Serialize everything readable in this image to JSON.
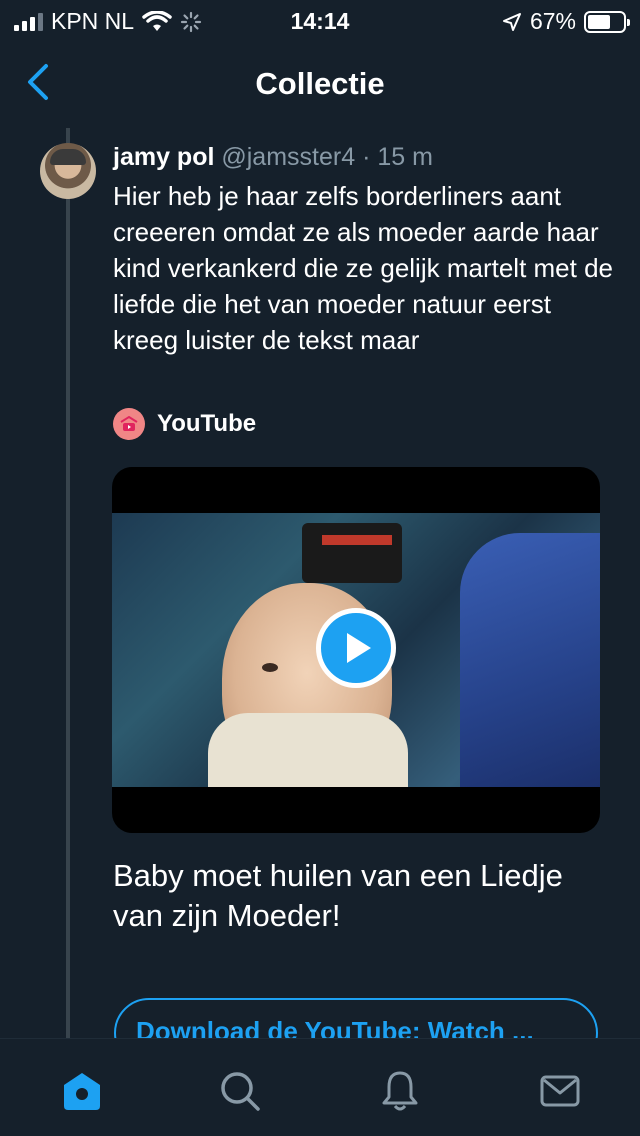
{
  "status_bar": {
    "carrier": "KPN NL",
    "time": "14:14",
    "battery": "67%"
  },
  "nav": {
    "title": "Collectie"
  },
  "tweet": {
    "name": "jamy pol",
    "handle": "@jamsster4",
    "separator": " · ",
    "age": "15 m",
    "text": "Hier heb je haar zelfs borderliners aant creeeren omdat ze als moeder aarde haar kind verkankerd die ze gelijk martelt met de liefde die het van moeder natuur eerst kreeg luister de tekst maar"
  },
  "card": {
    "source": "YouTube",
    "title": "Baby moet huilen van een Liedje van zijn Moeder!",
    "cta": "Download de YouTube: Watch ..."
  },
  "colors": {
    "background": "#15202b",
    "accent": "#1da1f2",
    "muted": "#8899a6"
  },
  "tabs": [
    {
      "name": "home-icon",
      "active": true
    },
    {
      "name": "search-icon",
      "active": false
    },
    {
      "name": "notifications-icon",
      "active": false
    },
    {
      "name": "messages-icon",
      "active": false
    }
  ]
}
